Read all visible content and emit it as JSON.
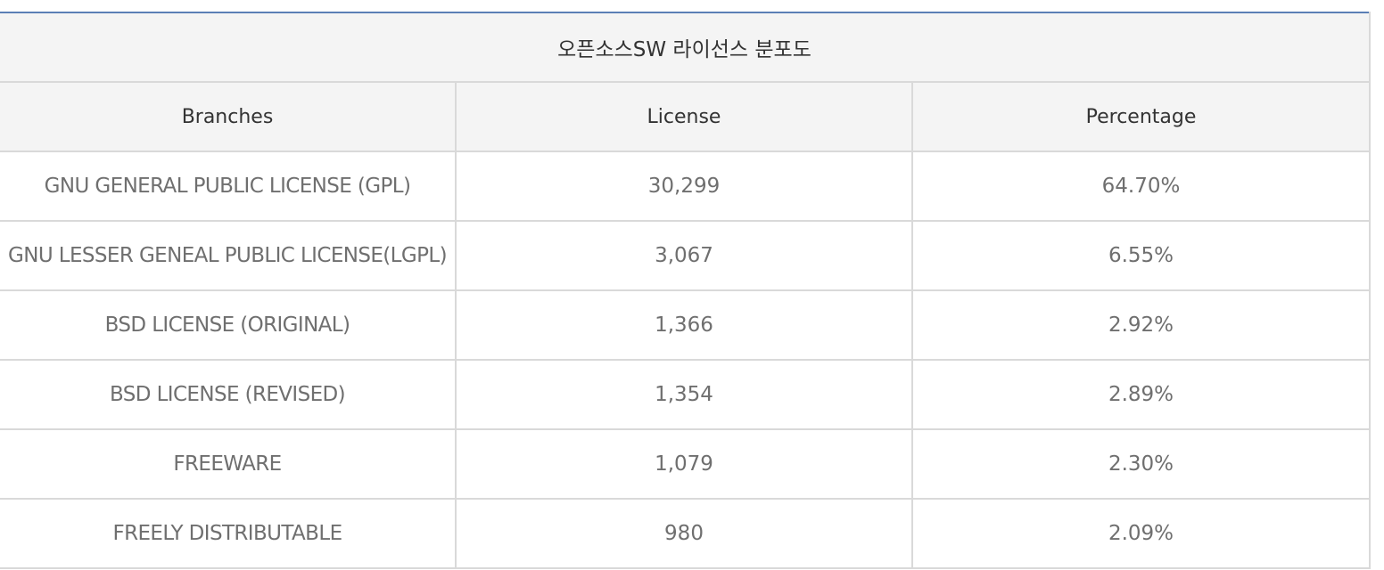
{
  "table": {
    "caption": "오픈소스SW 라이선스 분포도",
    "headers": [
      "Branches",
      "License",
      "Percentage"
    ],
    "rows": [
      {
        "branch": "GNU GENERAL PUBLIC LICENSE (GPL)",
        "license": "30,299",
        "percentage": "64.70%"
      },
      {
        "branch": "GNU LESSER GENEAL PUBLIC LICENSE(LGPL)",
        "license": "3,067",
        "percentage": "6.55%"
      },
      {
        "branch": "BSD LICENSE (ORIGINAL)",
        "license": "1,366",
        "percentage": "2.92%"
      },
      {
        "branch": "BSD LICENSE (REVISED)",
        "license": "1,354",
        "percentage": "2.89%"
      },
      {
        "branch": "FREEWARE",
        "license": "1,079",
        "percentage": "2.30%"
      },
      {
        "branch": "FREELY DISTRIBUTABLE",
        "license": "980",
        "percentage": "2.09%"
      }
    ]
  }
}
